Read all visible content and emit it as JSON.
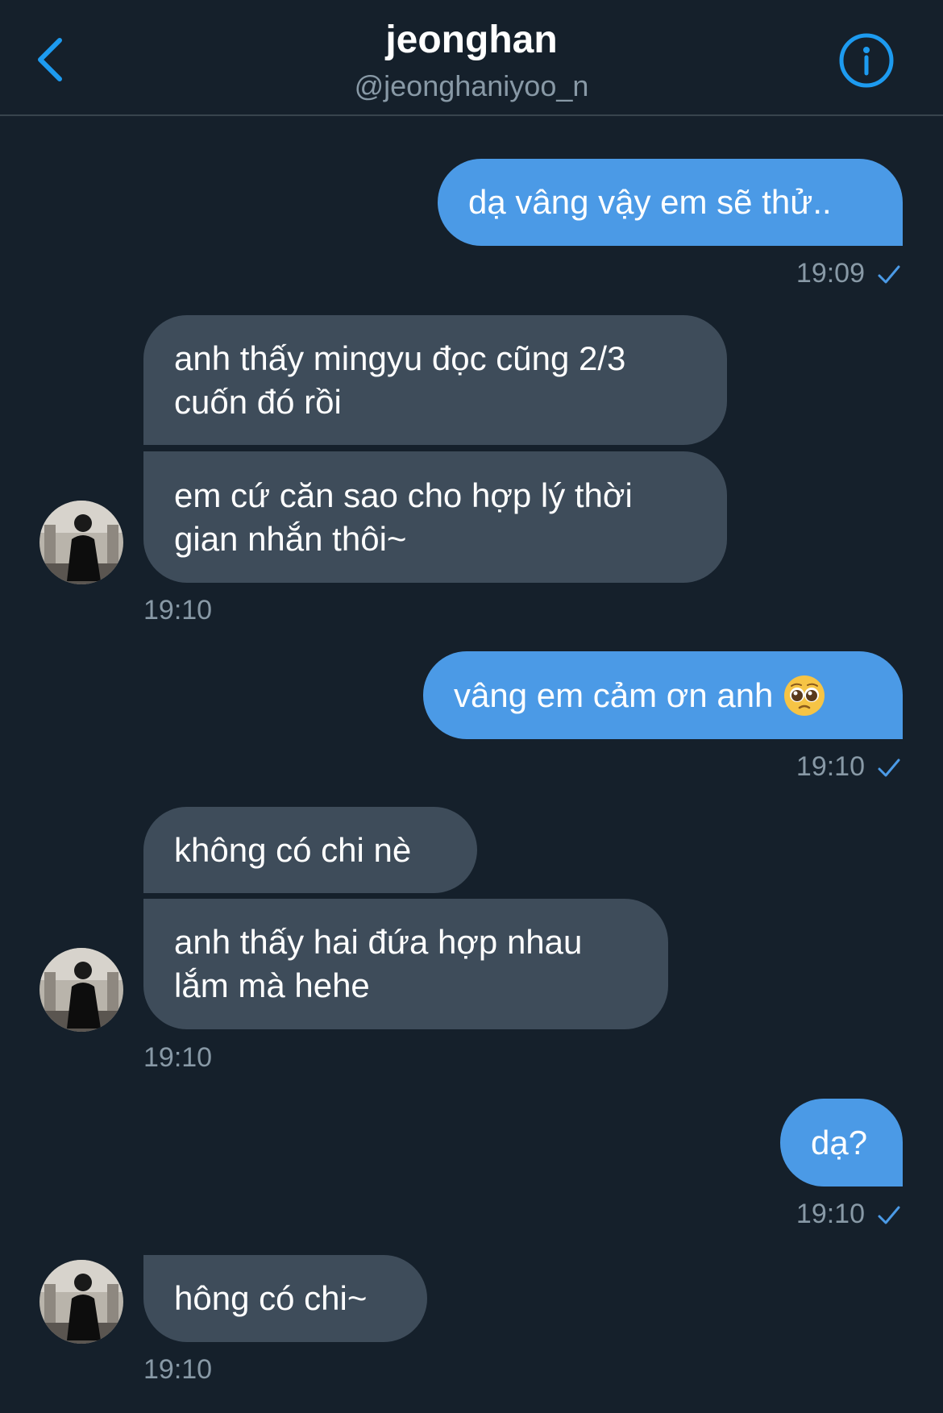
{
  "header": {
    "title": "jeonghan",
    "handle": "@jeonghaniyoo_n"
  },
  "messages": {
    "m1": {
      "text": "dạ vâng vậy em sẽ thử..",
      "time": "19:09"
    },
    "m2": {
      "text": "anh thấy mingyu đọc cũng 2/3 cuốn đó rồi"
    },
    "m3": {
      "text": "em cứ căn sao cho hợp lý thời gian nhắn thôi~",
      "time": "19:10"
    },
    "m4": {
      "text": "vâng em cảm ơn anh",
      "emoji": "pleading-face",
      "time": "19:10"
    },
    "m5": {
      "text": "không có chi nè"
    },
    "m6": {
      "text": "anh thấy hai đứa hợp nhau lắm mà hehe",
      "time": "19:10"
    },
    "m7": {
      "text": "dạ?",
      "time": "19:10"
    },
    "m8": {
      "text": "hông có chi~",
      "time": "19:10"
    }
  },
  "colors": {
    "background": "#15202b",
    "sent_bubble": "#4b9ae6",
    "received_bubble": "#3e4c5a",
    "accent": "#1d9bf0",
    "muted_text": "#8899a6"
  },
  "icons": {
    "back": "chevron-left-icon",
    "info": "info-circle-icon",
    "read_receipt": "checkmark-icon"
  }
}
